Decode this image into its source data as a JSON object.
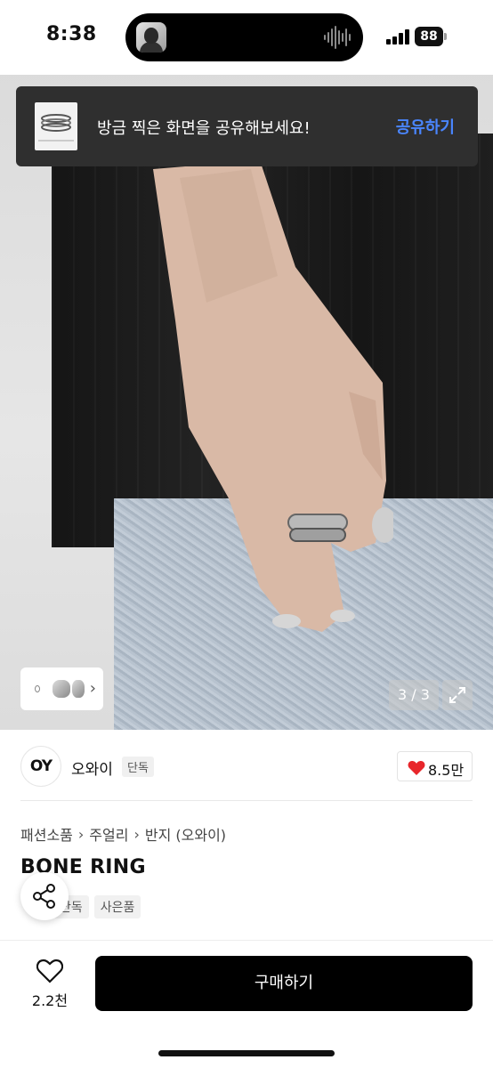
{
  "status_bar": {
    "time": "8:38",
    "battery": "88"
  },
  "toast": {
    "message": "방금 찍은 화면을 공유해보세요!",
    "action": "공유하기",
    "action_color": "#4a86ff"
  },
  "gallery": {
    "counter": "3 / 3"
  },
  "brand": {
    "logo_text": "OY",
    "name": "오와이",
    "badge": "단독",
    "likes": "8.5만"
  },
  "breadcrumb": {
    "items": [
      "패션소품",
      "주얼리",
      "반지 (오와이)"
    ]
  },
  "product": {
    "title": "BONE RING",
    "tags": [
      "단독",
      "사은품"
    ]
  },
  "bottom_bar": {
    "wish_count": "2.2천",
    "buy_label": "구매하기"
  },
  "icons": [
    "share-icon",
    "heart-icon",
    "expand-icon",
    "chevron-right-icon",
    "signal-icon",
    "battery-icon"
  ]
}
